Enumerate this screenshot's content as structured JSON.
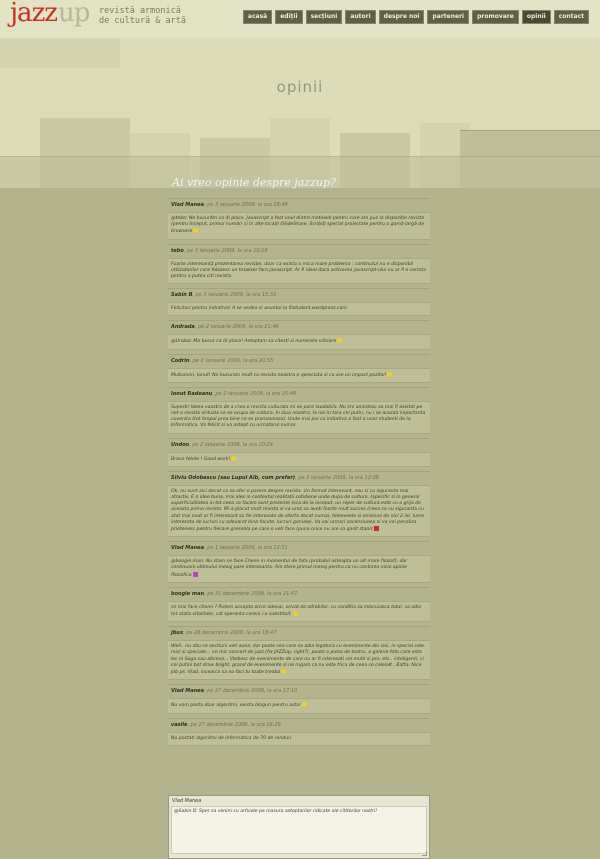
{
  "logo": {
    "jazz": "jazz",
    "up": "up",
    "tagline_1": "revistă armonică",
    "tagline_2": "de cultură & artă"
  },
  "nav": [
    "acasă",
    "ediții",
    "secțiuni",
    "autori",
    "despre noi",
    "parteneri",
    "promovare",
    "opinii",
    "contact"
  ],
  "nav_active": "opinii",
  "page_title": "opinii",
  "heading": "Ai vreo opinie despre jazzup?",
  "comments": [
    {
      "author": "Vlad Manea",
      "date": ", pe 3 ianuarie 2009, la ora 18:48",
      "text": "@tebo: Ne bucurăm ca iți place. Javascript a fost unul dintre motivele pentru care am pus la dispoziție revista (pentru început, primul număr) și în alte locații (SlideShare, Scribd) special proiectate pentru o gamă largă de browsere",
      "smiley": "yellow"
    },
    {
      "author": "tebo",
      "date": ", pe 3 ianuarie 2009, la ora 10:18",
      "text": "Foarte interesantă prezentarea revistei, doar ca exista o mica mare problema : continutul nu e disponibil utilizatorilor care folosesc un browser fara javascript. Ar fi ideal daca activarea javascript-ului nu ar fi o cerinta pentru a putea citi revista.",
      "smiley": ""
    },
    {
      "author": "Sabin B",
      "date": ", pe 3 ianuarie 2009, la ora 15:32",
      "text": "Felicitari pentru initiativa! A se vedea si anuntul la fiistudent.wordpress.com",
      "smiley": ""
    },
    {
      "author": "Andrada",
      "date": ", pe 2 ianuarie 2009, la ora 21:46",
      "text": "@Undoo: Ma bucur ca iti place! Asteptam sa citesti si numerele viitoare",
      "smiley": "yellow"
    },
    {
      "author": "Codrin",
      "date": ", pe 2 ianuarie 2009, la ora 20:55",
      "text": "Multumim, Ionut! Ne bucuram mult ca revista noastra e apreciata si ca are un impact pozitiv!",
      "smiley": "yellow"
    },
    {
      "author": "Ionut Radeanu",
      "date": ", pe 2 ianuarie 2009, la ora 20:48",
      "text": "Superb! Ideea voastra de a crea o revista culturala mi se pare laudabila. Nu imi amintesc sa mai fi existat pe net o revista virtuala ce se ocupa de cultura. In ziua noastra, la noi in tara cel putin, nu i se acorda importanta cuvenita (tot timpul prea bine ce se promoveaza). Unde mai pui ca initiativa a fost a unor studenti de la Informatica. Va felicit si va astept cu urmatorul numar.",
      "smiley": ""
    },
    {
      "author": "Undoo",
      "date": ", pe 2 ianuarie 2009, la ora 20:24",
      "text": "Bravo fetele ! Good work!",
      "smiley": "yellow"
    },
    {
      "author": "Silviu Odobescu (sau Lupul Alb, cum prefer)",
      "date": ", pe 2 ianuarie 2009, la ora 12:08",
      "text": "Ok, nu sunt aici decat ca sa ofer o parere despre revista. Un format interesant, nou si cu siguranta mai atractiv. E o idee buna, mai ales in contextul realitatii cotidiene unde dupa de cultura, (specific si in general superficialitatea in tot ceea ce facem sunt prezente inca de la inceput, un reper de cultura este cu o grija de aceasta prima revista. Mi-a placut mult revista si va urez sa aveti foarte mult succes (ceea ce cu siguranta cu atat mai mult ar fi interesant sa fie interesate de oferta decat numai, teleoveele si emisiuni de nici 2 lei, lume interesata de lucruri cu adevarat bine facute, lucruri geniale). Va voi urmari ascensiunea si va voi penaliza prietenesc pentru fiecare greseala pe care o veti face (puna orice nu are sa gasit stanic",
      "smiley": "red"
    },
    {
      "author": "Vlad Manea",
      "date": ", pe 1 ianuarie 2009, la ora 12:51",
      "text": "@boogie man: Nu stam ce face Chenn in momentul de fata (probabil asteapta un alt mare filozof), dar continuam ultimului mesaj pare interesanta. Am stere primul mesaj pentru ca nu continea nicio opinie filozofica",
      "smiley": "pink"
    },
    {
      "author": "boogie man",
      "date": ", pe 31 decembrie 2008, la ora 21:47",
      "text": "ce mai face chenn ? Putem accepta orice adevar, oricat de zdrobitor, cu conditia sa inlocuiasca totul, sa aiba tot atata vitalitate, cat speranta careia i-a substituit.",
      "smiley": "yellow"
    },
    {
      "author": "jbux",
      "date": ", pe 28 decembrie 2008, la ora 18:47",
      "text": "Well.. nu stiu ce sectiuni veti avea, dar poate cea care sa aiba legatura cu evenimente din iasi, in special cele mici si speciale... un mic concert de jazz (fix JAZZup, right?), poate o piesa de teatru, o galerie foto care este loc in Soga sau altceva... Vorbesc de evenimente de care nu ar fi interesati cei multi si pro, etc.. inteligenti, ci cei putini bot draw bright, grand de evenimente si ne rugam ca nu este frica de ceea ce celelalt . Bafta. Nice job ps. Vlad, incearca sa nu faci tu toate treaba",
      "smiley": "yellow"
    },
    {
      "author": "Vlad Manea",
      "date": ", pe 27 decembrie 2008, la ora 17:10",
      "text": "Nu vom posta doar algoritmi, exista bloguri pentru asta!",
      "smiley": "yellow"
    },
    {
      "author": "vasile",
      "date": ", pe 27 decembrie 2008, la ora 16:28",
      "text": "Nu postati algoritmi de informatica de 70 de randuri",
      "smiley": ""
    }
  ],
  "form": {
    "name": "Vlad Manea",
    "text": "@Sabin B: Sper sa venim cu articole pe masura asteptarilor ridicate ale cititorilor nostri!"
  }
}
